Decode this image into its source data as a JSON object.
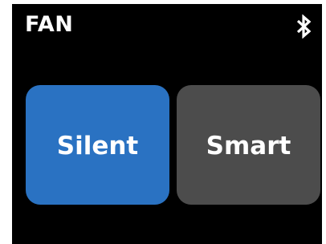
{
  "screen": {
    "title": "FAN",
    "status_icon": "bluetooth-icon",
    "background_color": "#000000"
  },
  "modes": [
    {
      "label": "Silent",
      "color": "#2a72c2",
      "selected": true
    },
    {
      "label": "Smart",
      "color": "#4c4c4c",
      "selected": false
    }
  ]
}
